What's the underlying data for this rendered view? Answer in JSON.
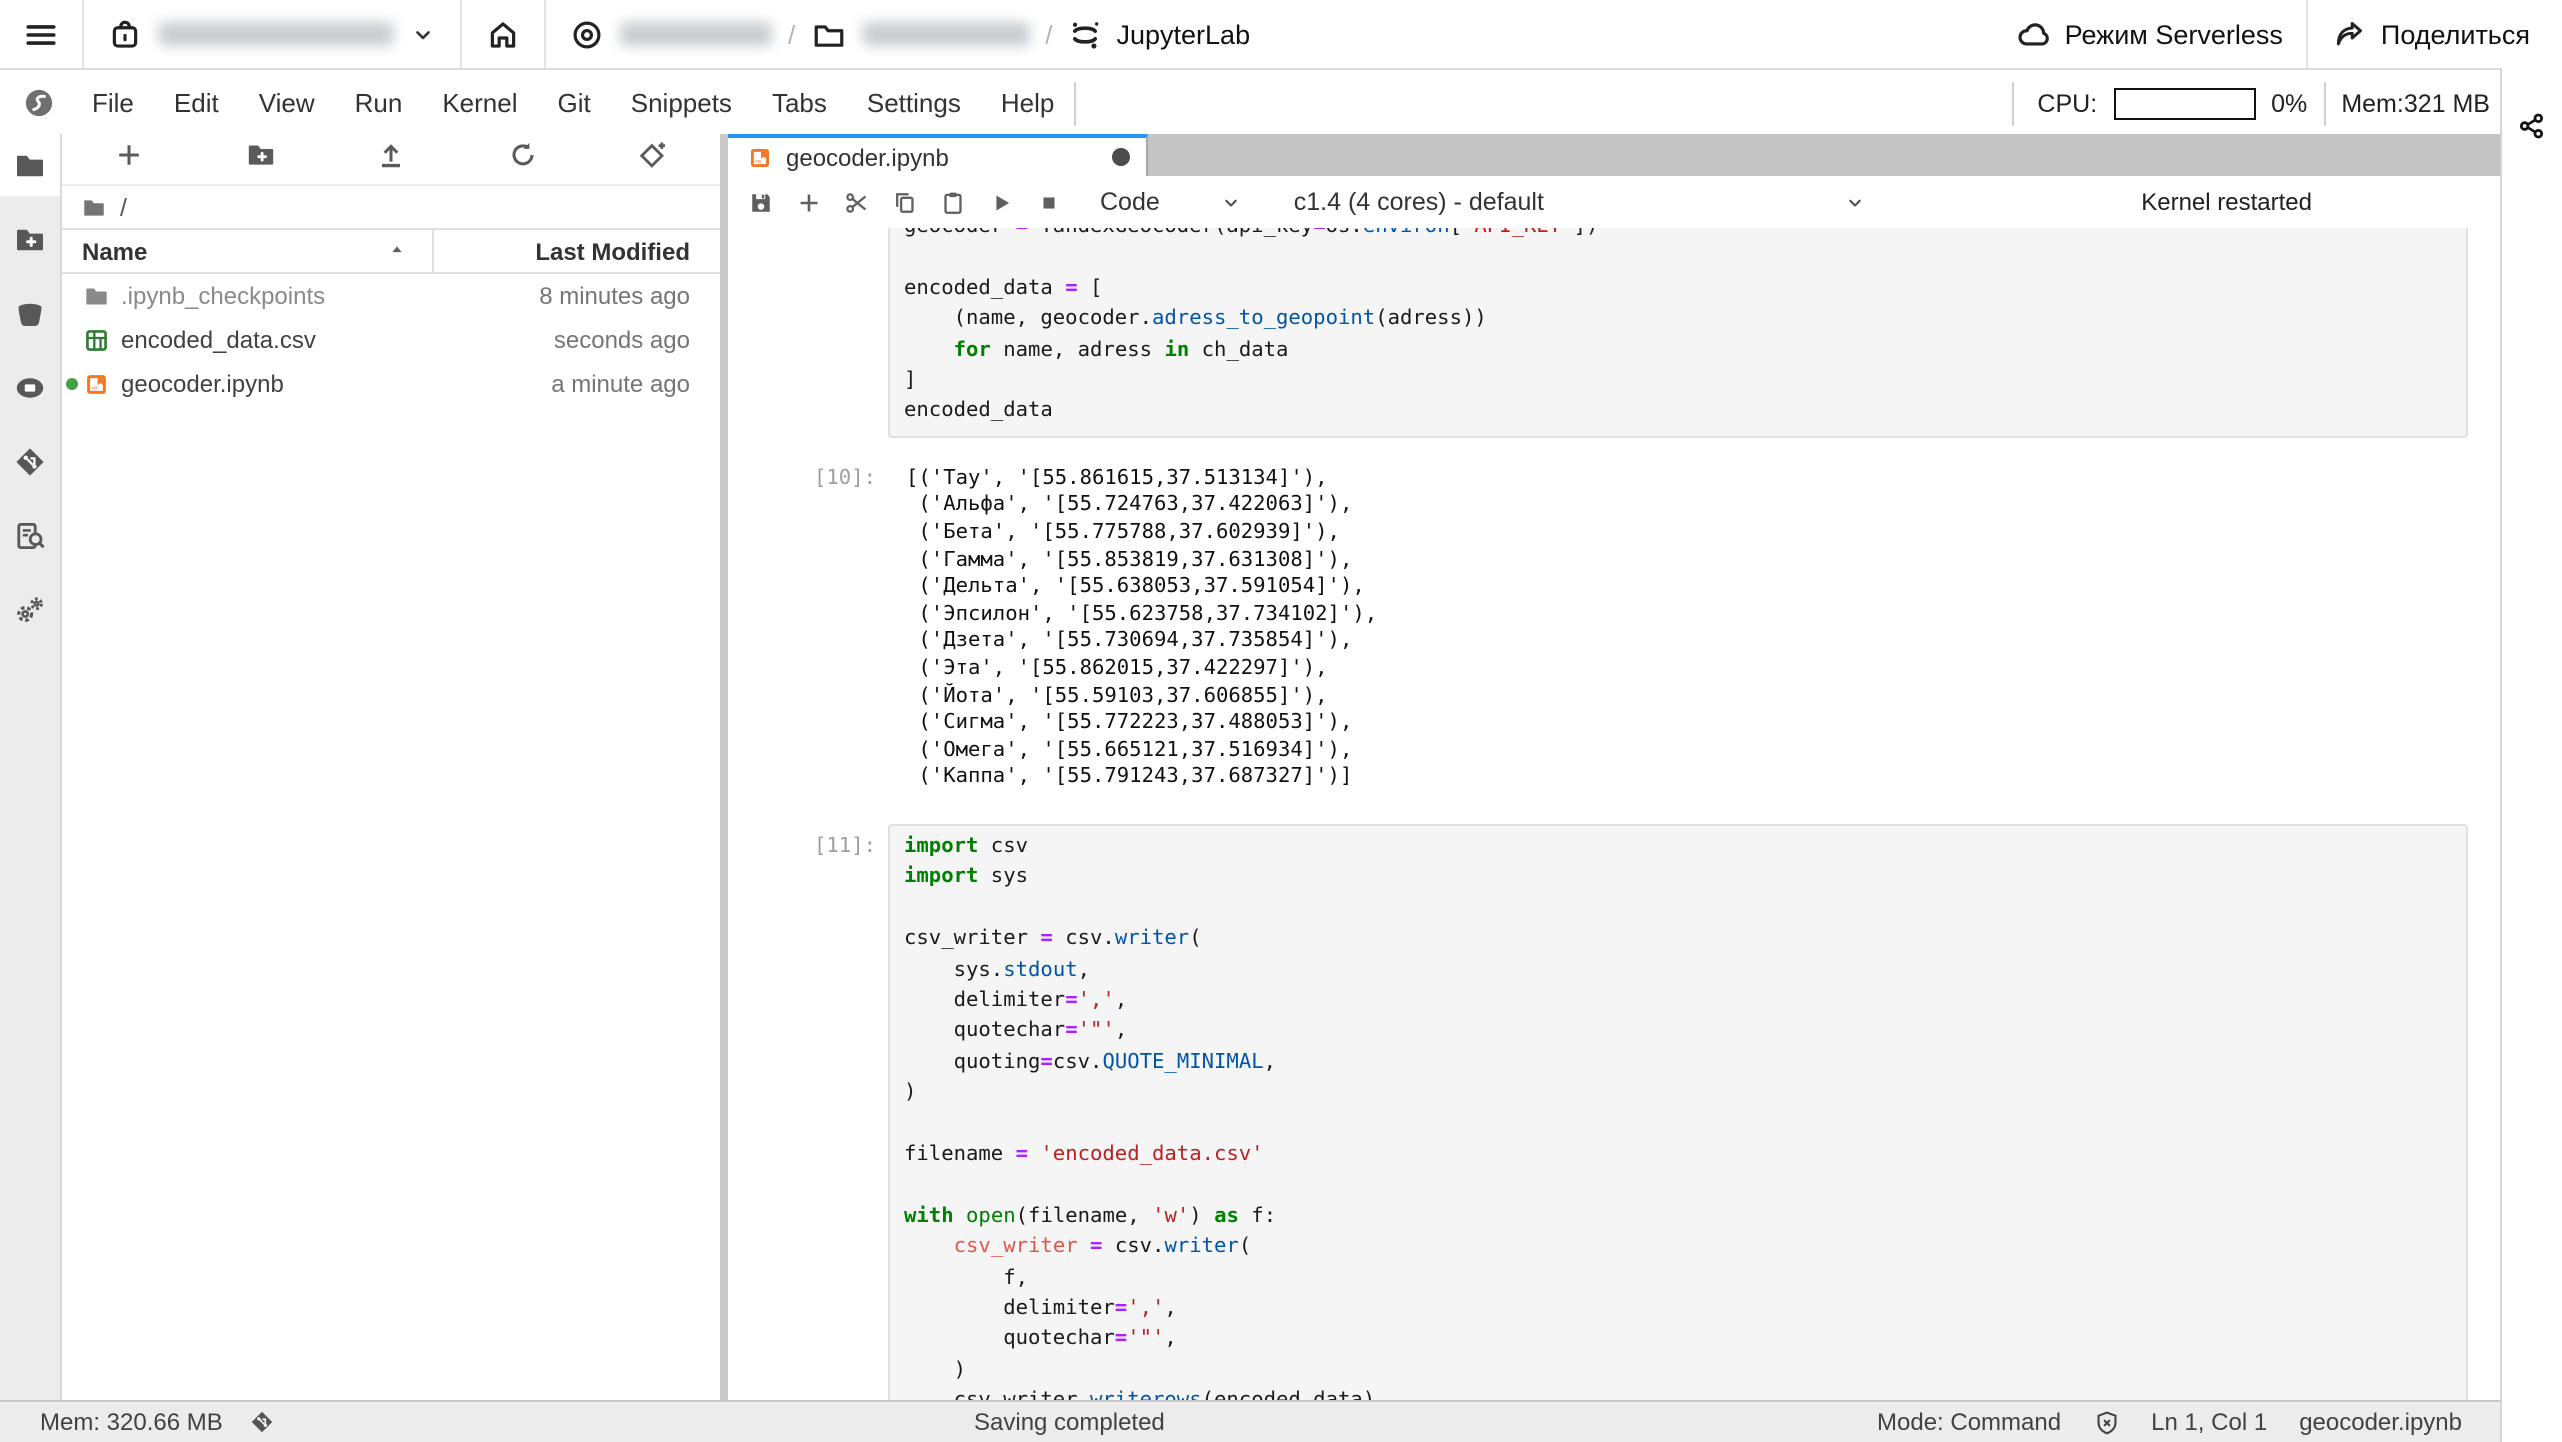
{
  "topbar": {
    "jupyterlab_label": "JupyterLab",
    "breadcrumb_separator": "/",
    "serverless_label": "Режим Serverless",
    "share_label": "Поделиться"
  },
  "menubar": {
    "items": [
      "File",
      "Edit",
      "View",
      "Run",
      "Kernel",
      "Git",
      "Snippets",
      "Tabs",
      "Settings",
      "Help"
    ],
    "cpu_label": "CPU:",
    "cpu_value": "0%",
    "mem_value": "Mem:321 MB"
  },
  "activity_bar": {
    "items": [
      {
        "name": "file-browser",
        "icon": "folder-filled",
        "active": true
      },
      {
        "name": "new-folder",
        "icon": "folder-plus"
      },
      {
        "name": "bucket",
        "icon": "bucket",
        "active": false
      },
      {
        "name": "containers",
        "icon": "container",
        "active": false
      },
      {
        "name": "git",
        "icon": "git-diamond",
        "active": false
      },
      {
        "name": "contents-search",
        "icon": "doc-search",
        "active": false
      },
      {
        "name": "settings",
        "icon": "gears",
        "active": false
      }
    ]
  },
  "file_browser": {
    "toolbar": [
      {
        "name": "new-launcher",
        "icon": "plus"
      },
      {
        "name": "new-folder",
        "icon": "folder-plus"
      },
      {
        "name": "upload",
        "icon": "upload"
      },
      {
        "name": "refresh",
        "icon": "refresh"
      },
      {
        "name": "git-init",
        "icon": "git-plus"
      }
    ],
    "path": "/",
    "columns": {
      "name": "Name",
      "modified": "Last Modified"
    },
    "files": [
      {
        "name": ".ipynb_checkpoints",
        "modified": "8 minutes ago",
        "icon": "folder-small",
        "dim": true,
        "open": false
      },
      {
        "name": "encoded_data.csv",
        "modified": "seconds ago",
        "icon": "csv-file",
        "dim": false,
        "open": false
      },
      {
        "name": "geocoder.ipynb",
        "modified": "a minute ago",
        "icon": "notebook-file",
        "dim": false,
        "open": true
      }
    ]
  },
  "notebook": {
    "tab": {
      "title": "geocoder.ipynb",
      "dirty": true
    },
    "toolbar": {
      "cell_type": "Code",
      "kernel": "c1.4 (4 cores) - default",
      "status": "Kernel restarted"
    },
    "cells": [
      {
        "type": "code",
        "prompt": "",
        "lines": [
          [
            [
              "t",
              "geocoder "
            ],
            [
              "o",
              "="
            ],
            [
              "t",
              " YandexGeocoder(api_key"
            ],
            [
              "o",
              "="
            ],
            [
              "t",
              "os."
            ],
            [
              "p",
              "environ"
            ],
            [
              "t",
              "["
            ],
            [
              "s",
              "'API_KEY'"
            ],
            [
              "t",
              "])"
            ]
          ],
          [],
          [
            [
              "t",
              "encoded_data "
            ],
            [
              "o",
              "="
            ],
            [
              "t",
              " ["
            ]
          ],
          [
            [
              "t",
              "    (name, geocoder."
            ],
            [
              "p",
              "adress_to_geopoint"
            ],
            [
              "t",
              "(adress))"
            ]
          ],
          [
            [
              "t",
              "    "
            ],
            [
              "k",
              "for"
            ],
            [
              "t",
              " name, adress "
            ],
            [
              "k",
              "in"
            ],
            [
              "t",
              " ch_data"
            ]
          ],
          [
            [
              "t",
              "]"
            ]
          ],
          [
            [
              "t",
              "encoded_data"
            ]
          ]
        ]
      },
      {
        "type": "output",
        "prompt": "[10]:",
        "lines": [
          "[('Тау', '[55.861615,37.513134]'),",
          " ('Альфа', '[55.724763,37.422063]'),",
          " ('Бета', '[55.775788,37.602939]'),",
          " ('Гамма', '[55.853819,37.631308]'),",
          " ('Дельта', '[55.638053,37.591054]'),",
          " ('Эпсилон', '[55.623758,37.734102]'),",
          " ('Дзета', '[55.730694,37.735854]'),",
          " ('Эта', '[55.862015,37.422297]'),",
          " ('Йота', '[55.59103,37.606855]'),",
          " ('Сигма', '[55.772223,37.488053]'),",
          " ('Омега', '[55.665121,37.516934]'),",
          " ('Каппа', '[55.791243,37.687327]')]"
        ]
      },
      {
        "type": "code",
        "prompt": "[11]:",
        "lines": [
          [
            [
              "k",
              "import"
            ],
            [
              "t",
              " csv"
            ]
          ],
          [
            [
              "k",
              "import"
            ],
            [
              "t",
              " sys"
            ]
          ],
          [],
          [
            [
              "t",
              "csv_writer "
            ],
            [
              "o",
              "="
            ],
            [
              "t",
              " csv."
            ],
            [
              "p",
              "writer"
            ],
            [
              "t",
              "("
            ]
          ],
          [
            [
              "t",
              "    sys."
            ],
            [
              "p",
              "stdout"
            ],
            [
              "t",
              ","
            ]
          ],
          [
            [
              "t",
              "    delimiter"
            ],
            [
              "o",
              "="
            ],
            [
              "s",
              "','"
            ],
            [
              "t",
              ","
            ]
          ],
          [
            [
              "t",
              "    quotechar"
            ],
            [
              "o",
              "="
            ],
            [
              "s",
              "'\"'"
            ],
            [
              "t",
              ","
            ]
          ],
          [
            [
              "t",
              "    quoting"
            ],
            [
              "o",
              "="
            ],
            [
              "t",
              "csv."
            ],
            [
              "p",
              "QUOTE_MINIMAL"
            ],
            [
              "t",
              ","
            ]
          ],
          [
            [
              "t",
              ")"
            ]
          ],
          [],
          [
            [
              "t",
              "filename "
            ],
            [
              "o",
              "="
            ],
            [
              "t",
              " "
            ],
            [
              "s",
              "'encoded_data.csv'"
            ]
          ],
          [],
          [
            [
              "k",
              "with"
            ],
            [
              "t",
              " "
            ],
            [
              "b",
              "open"
            ],
            [
              "t",
              "(filename, "
            ],
            [
              "s",
              "'w'"
            ],
            [
              "t",
              ") "
            ],
            [
              "k",
              "as"
            ],
            [
              "t",
              " f:"
            ]
          ],
          [
            [
              "t",
              "    "
            ],
            [
              "v",
              "csv_writer"
            ],
            [
              "t",
              " "
            ],
            [
              "o",
              "="
            ],
            [
              "t",
              " csv."
            ],
            [
              "p",
              "writer"
            ],
            [
              "t",
              "("
            ]
          ],
          [
            [
              "t",
              "        f,"
            ]
          ],
          [
            [
              "t",
              "        delimiter"
            ],
            [
              "o",
              "="
            ],
            [
              "s",
              "','"
            ],
            [
              "t",
              ","
            ]
          ],
          [
            [
              "t",
              "        quotechar"
            ],
            [
              "o",
              "="
            ],
            [
              "s",
              "'\"'"
            ],
            [
              "t",
              ","
            ]
          ],
          [
            [
              "t",
              "    )"
            ]
          ],
          [
            [
              "t",
              "    csv_writer."
            ],
            [
              "p",
              "writerows"
            ],
            [
              "t",
              "(encoded_data)"
            ]
          ]
        ]
      }
    ]
  },
  "statusbar": {
    "mem": "Mem: 320.66 MB",
    "message": "Saving completed",
    "mode": "Mode: Command",
    "cursor": "Ln 1, Col 1",
    "file": "geocoder.ipynb"
  },
  "colors": {
    "accent": "#2196f3",
    "keyword": "#008000",
    "operator": "#aa22ff",
    "property": "#0055aa",
    "string": "#ba2121",
    "variable_red": "#e4564a",
    "notebook_icon": "#f37726",
    "csv_icon": "#2e7d32",
    "running_dot": "#43a047"
  }
}
